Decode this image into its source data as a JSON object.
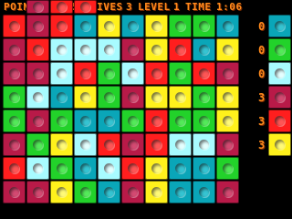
{
  "hud": {
    "points_label": "POINTS",
    "points_value": "225",
    "lives_label": "LIVES",
    "lives_value": "3",
    "level_label": "LEVEL",
    "level_value": "1",
    "time_label": "TIME",
    "time_value": "1:06"
  },
  "board": {
    "top_row": [
      "crimson",
      "red",
      "red"
    ],
    "rows": [
      [
        "red",
        "crimson",
        "red",
        "teal",
        "yellow",
        "teal",
        "yellow",
        "green",
        "green",
        "teal"
      ],
      [
        "crimson",
        "red",
        "cyan",
        "cyan",
        "cyan",
        "crimson",
        "yellow",
        "red",
        "teal",
        "yellow"
      ],
      [
        "crimson",
        "crimson",
        "cyan",
        "red",
        "green",
        "cyan",
        "red",
        "green",
        "red",
        "crimson"
      ],
      [
        "green",
        "cyan",
        "teal",
        "yellow",
        "green",
        "crimson",
        "yellow",
        "yellow",
        "green",
        "yellow"
      ],
      [
        "green",
        "crimson",
        "green",
        "teal",
        "teal",
        "green",
        "red",
        "green",
        "green",
        "yellow"
      ],
      [
        "crimson",
        "green",
        "yellow",
        "cyan",
        "red",
        "crimson",
        "red",
        "cyan",
        "cyan",
        "crimson"
      ],
      [
        "red",
        "cyan",
        "green",
        "teal",
        "cyan",
        "red",
        "yellow",
        "teal",
        "teal",
        "green"
      ],
      [
        "crimson",
        "crimson",
        "yellow",
        "green",
        "teal",
        "crimson",
        "yellow",
        "teal",
        "teal",
        "crimson"
      ]
    ]
  },
  "panel": [
    {
      "count": "0",
      "color": "teal"
    },
    {
      "count": "0",
      "color": "green"
    },
    {
      "count": "0",
      "color": "cyan"
    },
    {
      "count": "3",
      "color": "crimson"
    },
    {
      "count": "3",
      "color": "red"
    },
    {
      "count": "3",
      "color": "yellow"
    }
  ]
}
